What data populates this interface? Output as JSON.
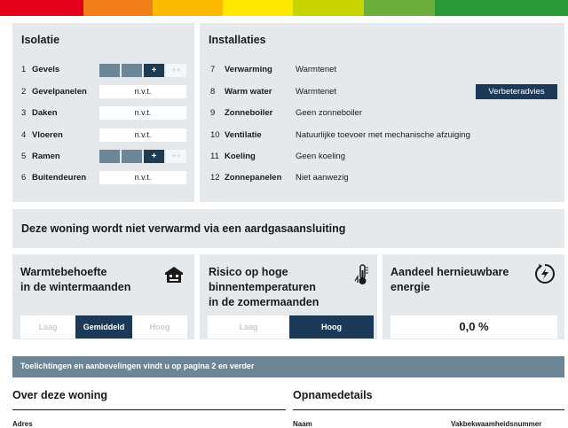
{
  "energy_bar": {
    "colors": [
      "#e3001b",
      "#f07e1a",
      "#fbb900",
      "#fee800",
      "#c8d400",
      "#6dae3f",
      "#2a9939"
    ]
  },
  "isolatie": {
    "title": "Isolatie",
    "items": [
      {
        "num": "1",
        "label": "Gevels",
        "type": "rating",
        "level": "+"
      },
      {
        "num": "2",
        "label": "Gevelpanelen",
        "type": "text",
        "value": "n.v.t."
      },
      {
        "num": "3",
        "label": "Daken",
        "type": "text",
        "value": "n.v.t."
      },
      {
        "num": "4",
        "label": "Vloeren",
        "type": "text",
        "value": "n.v.t."
      },
      {
        "num": "5",
        "label": "Ramen",
        "type": "rating",
        "level": "+"
      },
      {
        "num": "6",
        "label": "Buitendeuren",
        "type": "text",
        "value": "n.v.t."
      }
    ],
    "rating_plus": "+",
    "rating_plusplus": "++"
  },
  "installaties": {
    "title": "Installaties",
    "items": [
      {
        "num": "7",
        "label": "Verwarming",
        "value": "Warmtenet"
      },
      {
        "num": "8",
        "label": "Warm water",
        "value": "Warmtenet"
      },
      {
        "num": "9",
        "label": "Zonneboiler",
        "value": "Geen zonneboiler"
      },
      {
        "num": "10",
        "label": "Ventilatie",
        "value": "Natuurlijke toevoer met mechanische afzuiging"
      },
      {
        "num": "11",
        "label": "Koeling",
        "value": "Geen koeling"
      },
      {
        "num": "12",
        "label": "Zonnepanelen",
        "value": "Niet aanwezig"
      }
    ],
    "advice_button": "Verbeteradvies"
  },
  "gas_notice": "Deze woning wordt niet verwarmd via een aardgasaansluiting",
  "warmte": {
    "title_line1": "Warmtebehoefte",
    "title_line2": "in de wintermaanden",
    "options": [
      "Laag",
      "Gemiddeld",
      "Hoog"
    ],
    "selected": "Gemiddeld"
  },
  "risico": {
    "title_line1": "Risico op hoge",
    "title_line2": "binnentemperaturen",
    "title_line3": "in de zomermaanden",
    "options": [
      "Laag",
      "Hoog"
    ],
    "selected": "Hoog"
  },
  "hernieuwbaar": {
    "title_line1": "Aandeel hernieuwbare",
    "title_line2": "energie",
    "value": "0,0 %"
  },
  "info_bar": "Toelichtingen en aanbevelingen vindt u op pagina 2 en verder",
  "section_left": "Over deze woning",
  "section_right": "Opnamedetails",
  "bottom_left_label": "Adres",
  "bottom_mid_label": "Naam",
  "bottom_right_label": "Vakbekwaamheidsnummer"
}
